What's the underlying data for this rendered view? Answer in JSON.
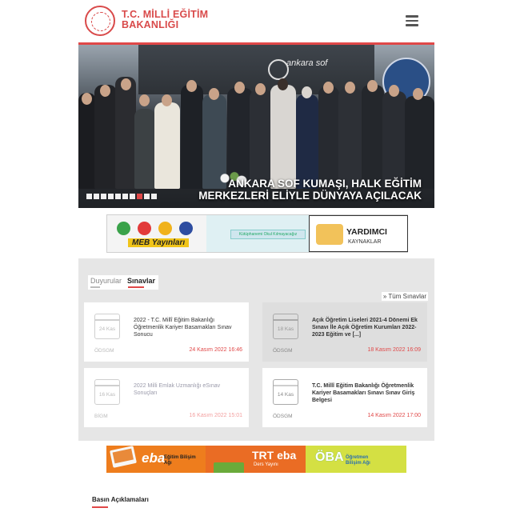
{
  "header": {
    "logo_line1": "T.C. MİLLİ EĞİTİM",
    "logo_line2": "BAKANLIĞI",
    "accent_color": "#e04848"
  },
  "slider": {
    "stage_text": "ankara sof",
    "caption_line1": "ANKARA SOF KUMAŞI, HALK EĞİTİM",
    "caption_line2": "MERKEZLERİ ELİYLE DÜNYAYA AÇILACAK",
    "total_dots": 10,
    "active_dot": 8
  },
  "promo1": {
    "meb_label": "MEB Yayınları",
    "library_label": "Kütüphanemi Okul Kılmayacağız",
    "yardimci_title": "YARDIMCI",
    "yardimci_sub": "KAYNAKLAR"
  },
  "tabs": {
    "items": [
      "Duyurular",
      "Sınavlar"
    ],
    "active": "Sınavlar",
    "all_link": "Tüm Sınavlar"
  },
  "cards": [
    {
      "date": "24 Kas",
      "title": "2022 - T.C. Millî Eğitim Bakanlığı Öğretmenlik Kariyer Basamakları Sınav Sonucu",
      "org": "ÖDSGM",
      "time": "24 Kasım 2022 16:46"
    },
    {
      "date": "18 Kas",
      "title": "Açık Öğretim Liseleri 2021-4 Dönemi Ek Sınavı İle Açık Öğretim Kurumları 2022-2023 Eğitim ve [...]",
      "org": "ÖDSGM",
      "time": "18 Kasım 2022 16:09"
    },
    {
      "date": "16 Kas",
      "title": "2022 Milli Emlak Uzmanlığı eSınav Sonuçları",
      "org": "BİGM",
      "time": "16 Kasım 2022 15:01"
    },
    {
      "date": "14 Kas",
      "title": "T.C. Millî Eğitim Bakanlığı Öğretmenlik Kariyer Basamakları Sınavı Sınav Giriş Belgesi",
      "org": "ÖDSGM",
      "time": "14 Kasım 2022 17:00"
    }
  ],
  "promo2": {
    "eba": "eba",
    "eba_sub": "Eğitim Bilişim Ağı",
    "trt": "TRT eba",
    "trt_sub": "Ders Yayını",
    "oba": "ÖBA",
    "oba_sub": "Öğretmen Bilişim Ağı"
  },
  "section_title": "Basın Açıklamaları"
}
